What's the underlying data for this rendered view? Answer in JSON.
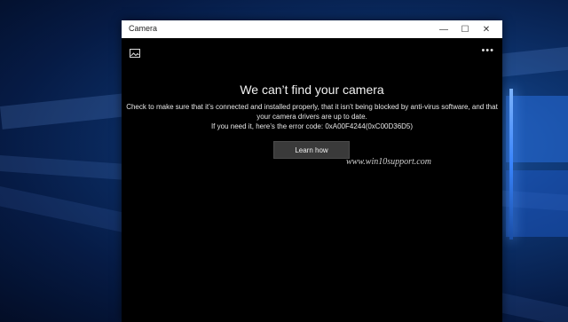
{
  "window": {
    "title": "Camera",
    "minimize_icon": "minimize-icon",
    "maximize_icon": "maximize-icon",
    "close_icon": "close-icon"
  },
  "toolbar": {
    "gallery_icon": "gallery-icon",
    "more_icon": "more-icon"
  },
  "error": {
    "heading": "We can’t find your camera",
    "line1": "Check to make sure that it’s connected and installed properly, that it isn’t being blocked by anti-virus software, and that",
    "line2": "your camera drivers are up to date.",
    "line3": "If you need it, here’s the error code: 0xA00F4244(0xC00D36D5)"
  },
  "learn_button": {
    "label": "Learn how"
  },
  "watermark": {
    "text": "www.win10support.com"
  },
  "colors": {
    "window_bg": "#000000",
    "titlebar_bg": "#ffffff",
    "button_bg": "#3a3a3a",
    "desktop_accent": "#1e5aa8"
  }
}
